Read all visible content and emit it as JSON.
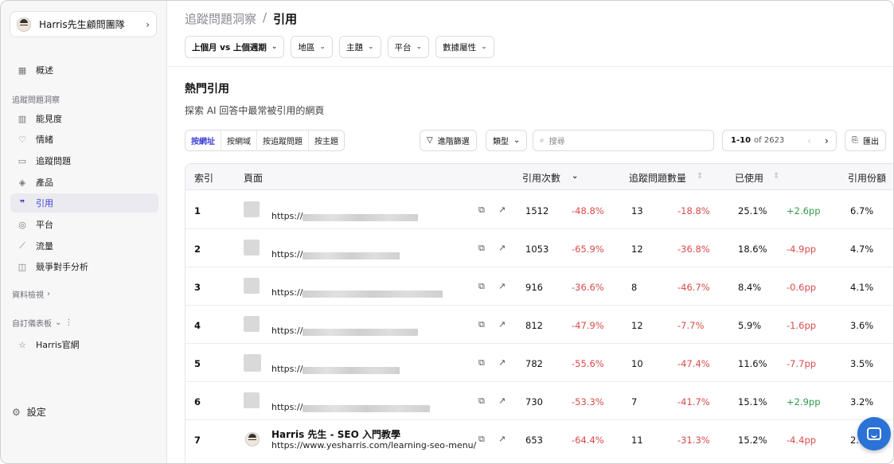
{
  "sidebar": {
    "team": "Harris先生顧問團隊",
    "overview": "概述",
    "insights_section": "追蹤問題洞察",
    "items": [
      "能見度",
      "情緒",
      "追蹤問題",
      "產品",
      "引用",
      "平台",
      "流量",
      "競爭對手分析"
    ],
    "data_view": "資料檢視",
    "custom_dashboards": "自訂儀表板",
    "dashboard_item": "Harris官網",
    "settings": "設定",
    "accent": "#3a3fd6"
  },
  "header": {
    "breadcrumb_parent": "追蹤問題洞察",
    "breadcrumb_sep": "/",
    "breadcrumb_current": "引用",
    "filters": [
      "上個月 vs 上個週期",
      "地區",
      "主題",
      "平台",
      "數據屬性"
    ]
  },
  "section": {
    "title": "熱門引用",
    "description": "探索 AI 回答中最常被引用的網頁"
  },
  "toolbar": {
    "tabs": [
      "按網址",
      "按網域",
      "按追蹤問題",
      "按主題"
    ],
    "advanced_filter": "進階篩選",
    "type": "類型",
    "search_placeholder": "搜尋",
    "range": "1-10",
    "of_total": "of 2623",
    "export": "匯出"
  },
  "table": {
    "columns": [
      "索引",
      "頁面",
      "引用次數",
      "追蹤問題數量",
      "已使用",
      "引用份額"
    ],
    "rows": [
      {
        "idx": "1",
        "url": "https://",
        "cites": "1512",
        "cites_chg": "-48.8%",
        "q": "13",
        "q_chg": "-18.8%",
        "used": "25.1%",
        "used_chg": "+2.6pp",
        "share": "6.7%"
      },
      {
        "idx": "2",
        "url": "https://",
        "cites": "1053",
        "cites_chg": "-65.9%",
        "q": "12",
        "q_chg": "-36.8%",
        "used": "18.6%",
        "used_chg": "-4.9pp",
        "share": "4.7%"
      },
      {
        "idx": "3",
        "url": "https://",
        "cites": "916",
        "cites_chg": "-36.6%",
        "q": "8",
        "q_chg": "-46.7%",
        "used": "8.4%",
        "used_chg": "-0.6pp",
        "share": "4.1%"
      },
      {
        "idx": "4",
        "url": "https://",
        "cites": "812",
        "cites_chg": "-47.9%",
        "q": "12",
        "q_chg": "-7.7%",
        "used": "5.9%",
        "used_chg": "-1.6pp",
        "share": "3.6%"
      },
      {
        "idx": "5",
        "url": "https://",
        "cites": "782",
        "cites_chg": "-55.6%",
        "q": "10",
        "q_chg": "-47.4%",
        "used": "11.6%",
        "used_chg": "-7.7pp",
        "share": "3.5%"
      },
      {
        "idx": "6",
        "url": "https://",
        "cites": "730",
        "cites_chg": "-53.3%",
        "q": "7",
        "q_chg": "-41.7%",
        "used": "15.1%",
        "used_chg": "+2.9pp",
        "share": "3.2%"
      },
      {
        "idx": "7",
        "title": "Harris 先生 - SEO 入門教學",
        "url": "https://www.yesharris.com/learning-seo-menu/",
        "cites": "653",
        "cites_chg": "-64.4%",
        "q": "11",
        "q_chg": "-31.3%",
        "used": "15.2%",
        "used_chg": "-4.4pp",
        "share": "2.9%"
      }
    ]
  }
}
